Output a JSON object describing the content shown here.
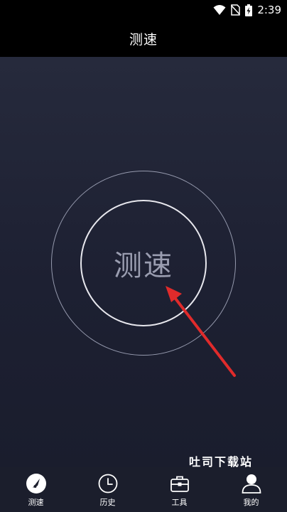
{
  "status_bar": {
    "time": "2:39",
    "icons": [
      "wifi-icon",
      "no-sim-icon",
      "battery-charging-icon"
    ]
  },
  "header": {
    "title": "测速"
  },
  "main": {
    "speed_button_label": "测速",
    "arrow_color": "#e02b2b",
    "watermark": "吐司下载站"
  },
  "bottom_nav": {
    "items": [
      {
        "label": "测速",
        "icon": "speedometer-icon"
      },
      {
        "label": "历史",
        "icon": "clock-icon"
      },
      {
        "label": "工具",
        "icon": "toolbox-icon"
      },
      {
        "label": "我的",
        "icon": "person-icon"
      }
    ]
  },
  "colors": {
    "background": "#1d2032",
    "nav_background": "#1b1e2c",
    "header_background": "#000000",
    "ring": "#e8e8ee",
    "label": "#9a9db0"
  }
}
